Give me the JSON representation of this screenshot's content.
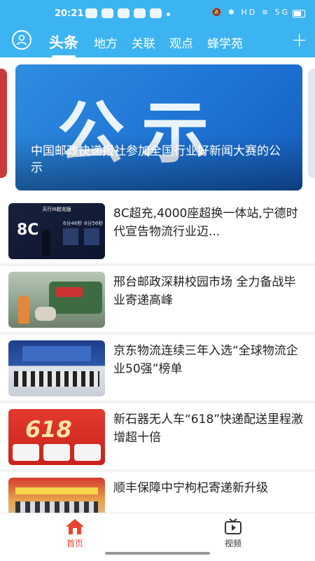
{
  "status_bar": {
    "time": "20:21",
    "right_indicators": "🔕 ✱ HD ≋ 5G"
  },
  "header": {
    "tabs": [
      {
        "label": "头条",
        "active": true
      },
      {
        "label": "地方",
        "active": false
      },
      {
        "label": "关联",
        "active": false
      },
      {
        "label": "观点",
        "active": false
      },
      {
        "label": "蜂学苑",
        "active": false
      }
    ],
    "add_label": "+"
  },
  "banner": {
    "image_text": "公示",
    "title": "中国邮政快递报社参加全国行业好新闻大赛的公示"
  },
  "news": [
    {
      "title": "8C超充,4000座超换一体站,宁德时代宣告物流行业迈..."
    },
    {
      "title": "邢台邮政深耕校园市场 全力备战毕业寄递高峰"
    },
    {
      "title": "京东物流连续三年入选“全球物流企业50强”榜单"
    },
    {
      "title": "新石器无人车“618”快递配送里程激增超十倍"
    },
    {
      "title": "顺丰保障中宁枸杞寄递新升级"
    }
  ],
  "thumb_text": {
    "item0_heading": "天行III超充版",
    "item0_big": "8C",
    "item0_small1": "6分46秒",
    "item0_small2": "8分56秒",
    "item3_badge": "618"
  },
  "bottom_nav": {
    "items": [
      {
        "label": "首页",
        "active": true
      },
      {
        "label": "视频",
        "active": false
      }
    ]
  },
  "colors": {
    "header": "#3db4f2",
    "active_nav": "#e8452f",
    "inactive_nav": "#333333"
  }
}
